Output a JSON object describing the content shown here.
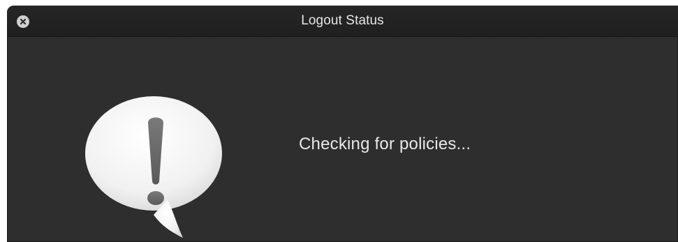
{
  "window": {
    "title": "Logout Status",
    "close_icon": "close-icon"
  },
  "alert": {
    "icon": "alert-speech-bubble-icon",
    "message": "Checking for policies..."
  },
  "colors": {
    "window_background": "#2e2e2e",
    "titlebar_background": "#222222",
    "text": "#e8e8e8",
    "close_button": "#cfcfcf"
  }
}
